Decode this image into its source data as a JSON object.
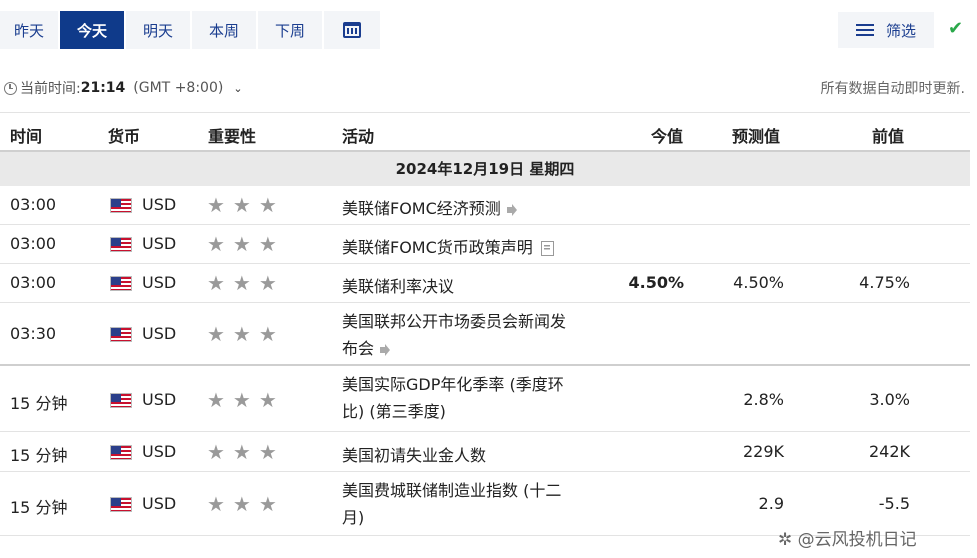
{
  "tabs": {
    "yesterday": "昨天",
    "today": "今天",
    "tomorrow": "明天",
    "this_week": "本周",
    "next_week": "下周",
    "calendar_icon": "calendar-icon"
  },
  "filter": {
    "label": "筛选",
    "icon": "filter-sliders-icon"
  },
  "check": "✔",
  "timebar": {
    "prefix": "当前时间:",
    "time": "21:14",
    "zone": "(GMT +8:00)",
    "chevron": "⌄"
  },
  "auto_update": "所有数据自动即时更新.",
  "table": {
    "headers": {
      "time": "时间",
      "currency": "货币",
      "importance": "重要性",
      "event": "活动",
      "actual": "今值",
      "forecast": "预测值",
      "previous": "前值"
    },
    "date_label": "2024年12月19日  星期四",
    "rows": [
      {
        "time": "03:00",
        "currency": "USD",
        "stars": "★★★",
        "event": "美联储FOMC经济预测",
        "icon": "sound-icon",
        "actual": "",
        "forecast": "",
        "previous": ""
      },
      {
        "time": "03:00",
        "currency": "USD",
        "stars": "★★★",
        "event": "美联储FOMC货币政策声明",
        "icon": "document-icon",
        "actual": "",
        "forecast": "",
        "previous": ""
      },
      {
        "time": "03:00",
        "currency": "USD",
        "stars": "★★★",
        "event": "美联储利率决议",
        "icon": "",
        "actual": "4.50%",
        "forecast": "4.50%",
        "previous": "4.75%"
      },
      {
        "time": "03:30",
        "currency": "USD",
        "stars": "★★★",
        "event_line1": "美国联邦公开市场委员会新闻发",
        "event_line2": "布会",
        "icon": "sound-icon",
        "actual": "",
        "forecast": "",
        "previous": ""
      },
      {
        "time": "15 分钟",
        "currency": "USD",
        "stars": "★★★",
        "event_line1": "美国实际GDP年化季率 (季度环",
        "event_line2": "比) (第三季度)",
        "actual": "",
        "forecast": "2.8%",
        "previous": "3.0%"
      },
      {
        "time": "15 分钟",
        "currency": "USD",
        "stars": "★★★",
        "event": "美国初请失业金人数",
        "actual": "",
        "forecast": "229K",
        "previous": "242K"
      },
      {
        "time": "15 分钟",
        "currency": "USD",
        "stars": "★★★",
        "event_line1": "美国费城联储制造业指数 (十二",
        "event_line2": "月)",
        "actual": "",
        "forecast": "2.9",
        "previous": "-5.5"
      }
    ]
  },
  "watermark": "✲ @云风投机日记"
}
